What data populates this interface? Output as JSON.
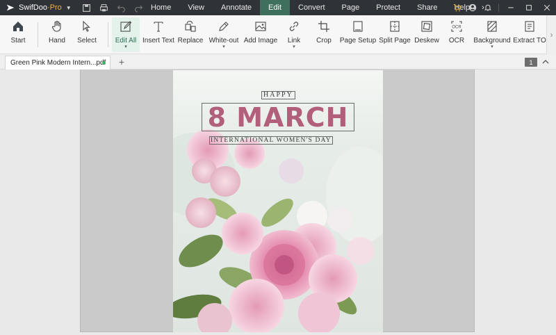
{
  "app": {
    "name": "SwifDoo",
    "edition": "·Pro"
  },
  "menu": [
    "Home",
    "View",
    "Annotate",
    "Edit",
    "Convert",
    "Page",
    "Protect",
    "Share",
    "Help"
  ],
  "menu_active": "Edit",
  "ribbon": {
    "start": "Start",
    "hand": "Hand",
    "select": "Select",
    "edit_all": "Edit All",
    "insert_text": "Insert Text",
    "replace": "Replace",
    "white_out": "White-out",
    "add_image": "Add Image",
    "link": "Link",
    "crop": "Crop",
    "page_setup": "Page Setup",
    "split_page": "Split Page",
    "deskew": "Deskew",
    "ocr": "OCR",
    "background": "Background",
    "extract": "Extract TO"
  },
  "tab": {
    "name": "Green Pink Modern Intern...pdf",
    "add": "+"
  },
  "page_indicator": "1",
  "document": {
    "line1": "HAPPY",
    "line2": "8 MARCH",
    "line3": "INTERNATIONAL WOMEN'S DAY"
  },
  "colors": {
    "title_bg": "#2f3338",
    "active_menu": "#3f6f5d",
    "headline": "#b25f7c",
    "brand_accent": "#f0b23a"
  }
}
